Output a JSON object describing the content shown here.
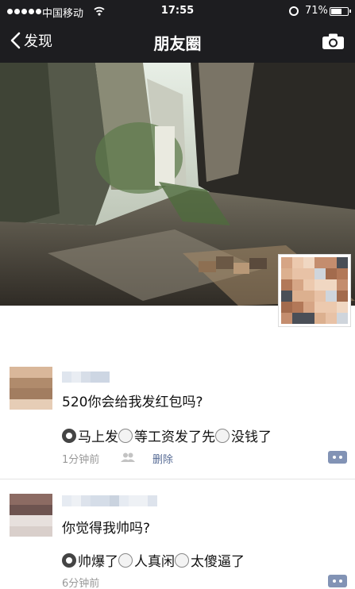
{
  "status_bar": {
    "carrier": "中国移动",
    "time": "17:55",
    "battery_text": "71%",
    "battery_level": 0.71,
    "icons": [
      "signal-dots-icon",
      "wifi-icon",
      "alarm-icon",
      "battery-icon"
    ]
  },
  "nav": {
    "back_label": "发现",
    "title": "朋友圈",
    "icons": [
      "chevron-left-icon",
      "camera-icon"
    ]
  },
  "posts": [
    {
      "text": "520你会给我发红包吗?",
      "options": [
        {
          "label": "马上发",
          "selected": true
        },
        {
          "label": "等工资发了先",
          "selected": false
        },
        {
          "label": "没钱了",
          "selected": false
        }
      ],
      "time": "1分钟前",
      "delete_label": "删除"
    },
    {
      "text": "你觉得我帅吗?",
      "options": [
        {
          "label": "帅爆了",
          "selected": true
        },
        {
          "label": "人真闲",
          "selected": false
        },
        {
          "label": "太傻逼了",
          "selected": false
        }
      ],
      "time": "6分钟前"
    }
  ],
  "colors": {
    "nav_background": "#1d1d20",
    "link": "#576b95",
    "meta_text": "#999999",
    "comment_button": "#8293b5"
  }
}
